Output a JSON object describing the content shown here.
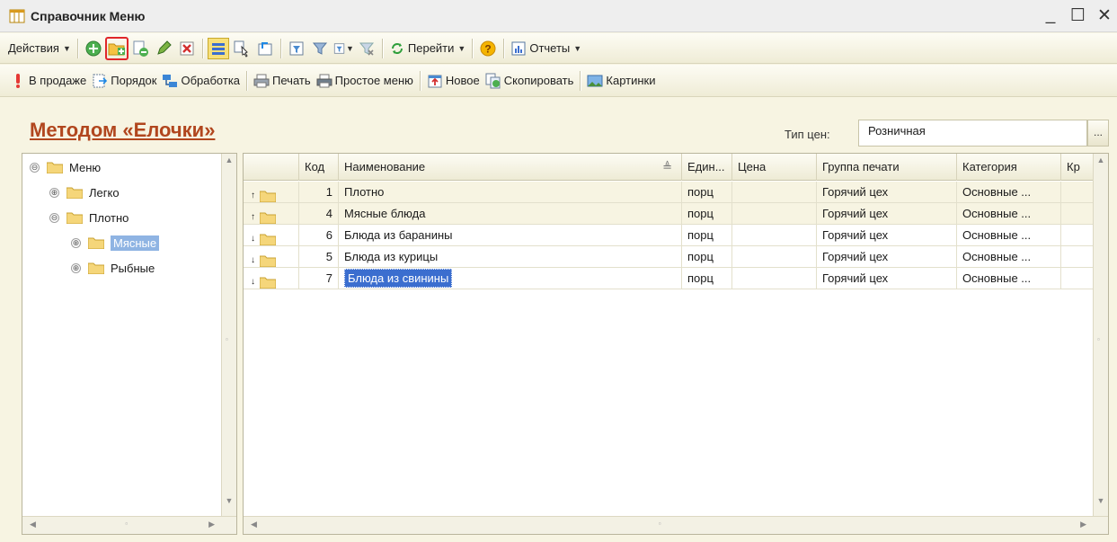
{
  "window": {
    "title": "Справочник Меню",
    "controls": {
      "minimize": "_",
      "maximize": "☐",
      "close": "✕"
    }
  },
  "toolbar1": {
    "actions_label": "Действия",
    "goto_label": "Перейти",
    "reports_label": "Отчеты",
    "help_label": "?"
  },
  "toolbar2": {
    "items": [
      {
        "label": "В продаже",
        "icon": "exclamation-icon"
      },
      {
        "label": "Порядок",
        "icon": "order-icon"
      },
      {
        "label": "Обработка",
        "icon": "processing-icon"
      },
      {
        "label": "Печать",
        "icon": "printer-icon"
      },
      {
        "label": "Простое меню",
        "icon": "simple-menu-icon"
      },
      {
        "label": "Новое",
        "icon": "new-icon"
      },
      {
        "label": "Скопировать",
        "icon": "copy-icon"
      },
      {
        "label": "Картинки",
        "icon": "pictures-icon"
      }
    ]
  },
  "heading": {
    "title": "Методом «Елочки»",
    "price_type_label": "Тип цен:",
    "price_type_value": "Розничная",
    "price_button": "..."
  },
  "tree": {
    "items": [
      {
        "label": "Меню",
        "expander": "⊖"
      },
      {
        "label": "Легко",
        "expander": "⊕"
      },
      {
        "label": "Плотно",
        "expander": "⊖"
      },
      {
        "label": "Мясные",
        "expander": "⊕"
      },
      {
        "label": "Рыбные",
        "expander": "⊕"
      }
    ]
  },
  "grid": {
    "columns": [
      "",
      "Код",
      "Наименование",
      "Един...",
      "Цена",
      "Группа печати",
      "Категория",
      "Кр"
    ],
    "rows": [
      {
        "dir": "up",
        "code": "1",
        "name": "Плотно",
        "unit": "порц",
        "price": "",
        "print_group": "Горячий цех",
        "category": "Основные ..."
      },
      {
        "dir": "up",
        "code": "4",
        "name": "Мясные блюда",
        "unit": "порц",
        "price": "",
        "print_group": "Горячий цех",
        "category": "Основные ..."
      },
      {
        "dir": "down",
        "code": "6",
        "name": "Блюда из баранины",
        "unit": "порц",
        "price": "",
        "print_group": "Горячий цех",
        "category": "Основные ..."
      },
      {
        "dir": "down",
        "code": "5",
        "name": "Блюда из курицы",
        "unit": "порц",
        "price": "",
        "print_group": "Горячий цех",
        "category": "Основные ..."
      },
      {
        "dir": "down",
        "code": "7",
        "name": "Блюда из свинины",
        "unit": "порц",
        "price": "",
        "print_group": "Горячий цех",
        "category": "Основные ..."
      }
    ]
  },
  "colors": {
    "title_accent": "#b1461e",
    "selection": "#3b6ecf",
    "toolbar_bg": "#efecd6",
    "highlight_box": "#e0262a"
  }
}
